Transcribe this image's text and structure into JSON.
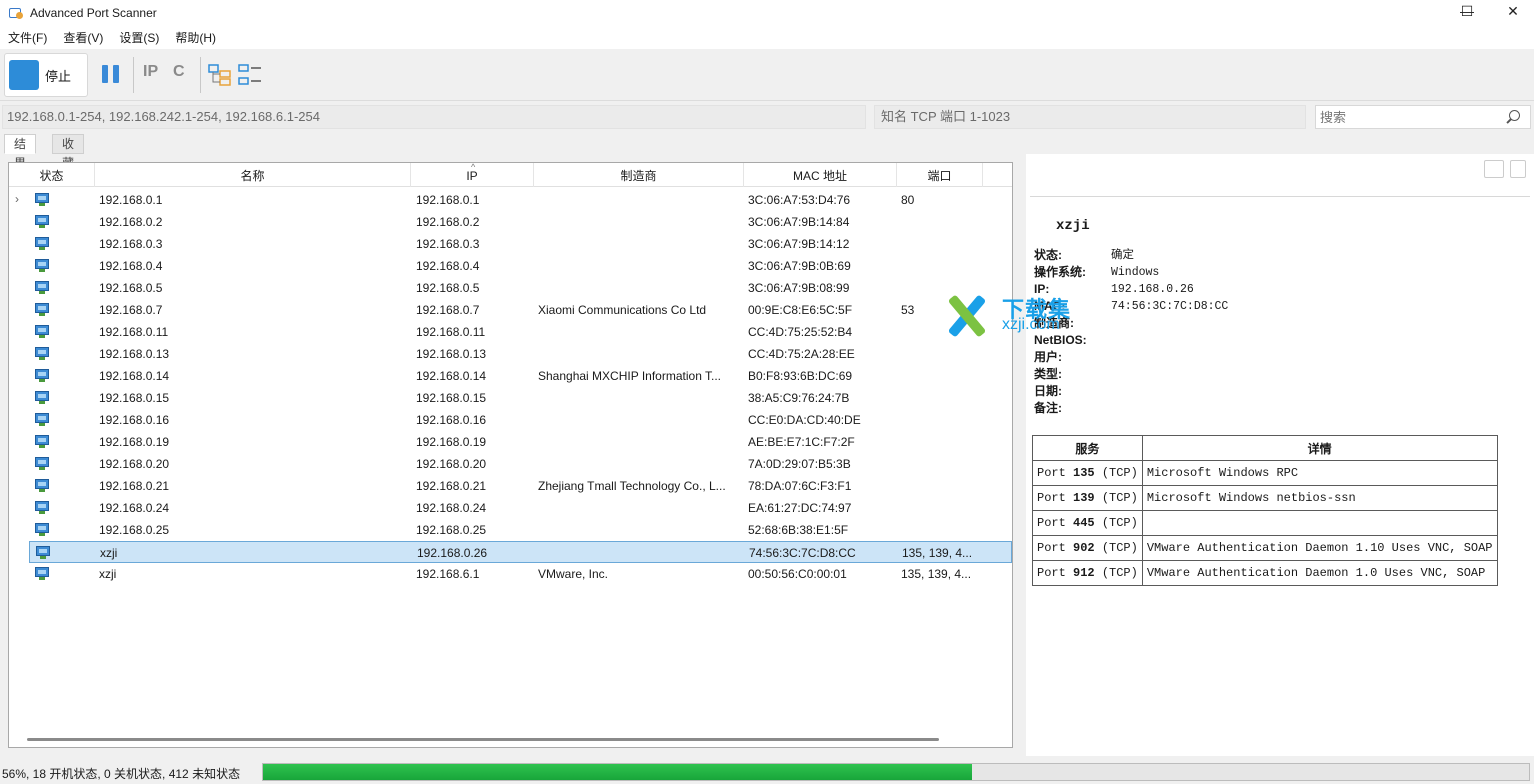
{
  "window": {
    "title": "Advanced Port Scanner",
    "minimize": "—",
    "maximize": "☐",
    "close": "✕"
  },
  "menu": [
    "文件(F)",
    "查看(V)",
    "设置(S)",
    "帮助(H)"
  ],
  "toolbar": {
    "stop_label": "停止",
    "ip_icon": "IP",
    "c_icon": "C"
  },
  "address": {
    "range": "192.168.0.1-254, 192.168.242.1-254, 192.168.6.1-254",
    "ports": "知名 TCP 端口 1-1023",
    "search_placeholder": "搜索"
  },
  "tabs": [
    "结果",
    "收藏夹"
  ],
  "table": {
    "columns": [
      "状态",
      "名称",
      "IP",
      "制造商",
      "MAC 地址",
      "端口"
    ],
    "rows": [
      {
        "name": "192.168.0.1",
        "ip": "192.168.0.1",
        "vendor": "",
        "mac": "3C:06:A7:53:D4:76",
        "ports": "80",
        "expand": "›"
      },
      {
        "name": "192.168.0.2",
        "ip": "192.168.0.2",
        "vendor": "",
        "mac": "3C:06:A7:9B:14:84",
        "ports": ""
      },
      {
        "name": "192.168.0.3",
        "ip": "192.168.0.3",
        "vendor": "",
        "mac": "3C:06:A7:9B:14:12",
        "ports": ""
      },
      {
        "name": "192.168.0.4",
        "ip": "192.168.0.4",
        "vendor": "",
        "mac": "3C:06:A7:9B:0B:69",
        "ports": ""
      },
      {
        "name": "192.168.0.5",
        "ip": "192.168.0.5",
        "vendor": "",
        "mac": "3C:06:A7:9B:08:99",
        "ports": ""
      },
      {
        "name": "192.168.0.7",
        "ip": "192.168.0.7",
        "vendor": "Xiaomi Communications Co Ltd",
        "mac": "00:9E:C8:E6:5C:5F",
        "ports": "53"
      },
      {
        "name": "192.168.0.11",
        "ip": "192.168.0.11",
        "vendor": "",
        "mac": "CC:4D:75:25:52:B4",
        "ports": ""
      },
      {
        "name": "192.168.0.13",
        "ip": "192.168.0.13",
        "vendor": "",
        "mac": "CC:4D:75:2A:28:EE",
        "ports": ""
      },
      {
        "name": "192.168.0.14",
        "ip": "192.168.0.14",
        "vendor": "Shanghai MXCHIP Information T...",
        "mac": "B0:F8:93:6B:DC:69",
        "ports": ""
      },
      {
        "name": "192.168.0.15",
        "ip": "192.168.0.15",
        "vendor": "",
        "mac": "38:A5:C9:76:24:7B",
        "ports": ""
      },
      {
        "name": "192.168.0.16",
        "ip": "192.168.0.16",
        "vendor": "",
        "mac": "CC:E0:DA:CD:40:DE",
        "ports": ""
      },
      {
        "name": "192.168.0.19",
        "ip": "192.168.0.19",
        "vendor": "",
        "mac": "AE:BE:E7:1C:F7:2F",
        "ports": ""
      },
      {
        "name": "192.168.0.20",
        "ip": "192.168.0.20",
        "vendor": "",
        "mac": "7A:0D:29:07:B5:3B",
        "ports": ""
      },
      {
        "name": "192.168.0.21",
        "ip": "192.168.0.21",
        "vendor": "Zhejiang Tmall Technology Co., L...",
        "mac": "78:DA:07:6C:F3:F1",
        "ports": ""
      },
      {
        "name": "192.168.0.24",
        "ip": "192.168.0.24",
        "vendor": "",
        "mac": "EA:61:27:DC:74:97",
        "ports": ""
      },
      {
        "name": "192.168.0.25",
        "ip": "192.168.0.25",
        "vendor": "",
        "mac": "52:68:6B:38:E1:5F",
        "ports": ""
      },
      {
        "name": "xzji",
        "ip": "192.168.0.26",
        "vendor": "",
        "mac": "74:56:3C:7C:D8:CC",
        "ports": "135, 139, 4...",
        "selected": true
      },
      {
        "name": "xzji",
        "ip": "192.168.6.1",
        "vendor": "VMware, Inc.",
        "mac": "00:50:56:C0:00:01",
        "ports": "135, 139, 4..."
      }
    ]
  },
  "status": {
    "text": "56%, 18 开机状态, 0 关机状态, 412 未知状态",
    "progress_fraction": 0.56
  },
  "details": {
    "host": "xzji",
    "fields": [
      {
        "k": "状态:",
        "v": "确定"
      },
      {
        "k": "操作系统:",
        "v": "Windows"
      },
      {
        "k": "IP:",
        "v": "192.168.0.26"
      },
      {
        "k": "MAC:",
        "v": "74:56:3C:7C:D8:CC"
      },
      {
        "k": "制造商:",
        "v": ""
      },
      {
        "k": "NetBIOS:",
        "v": ""
      },
      {
        "k": "用户:",
        "v": ""
      },
      {
        "k": "类型:",
        "v": ""
      },
      {
        "k": "日期:",
        "v": ""
      },
      {
        "k": "备注:",
        "v": ""
      }
    ],
    "services_header": [
      "服务",
      "详情"
    ],
    "services": [
      {
        "port": "135",
        "proto": "(TCP)",
        "detail": "Microsoft Windows RPC"
      },
      {
        "port": "139",
        "proto": "(TCP)",
        "detail": "Microsoft Windows netbios-ssn"
      },
      {
        "port": "445",
        "proto": "(TCP)",
        "detail": ""
      },
      {
        "port": "902",
        "proto": "(TCP)",
        "detail": "VMware Authentication Daemon 1.10 Uses VNC, SOAP"
      },
      {
        "port": "912",
        "proto": "(TCP)",
        "detail": "VMware Authentication Daemon 1.0 Uses VNC, SOAP"
      }
    ],
    "port_word": "Port"
  },
  "watermark": {
    "line1": "下载集",
    "line2": "xzji.com"
  },
  "colors": {
    "accent": "#2d8cd8",
    "selection": "#cce4f7",
    "progress": "#1fb443"
  }
}
